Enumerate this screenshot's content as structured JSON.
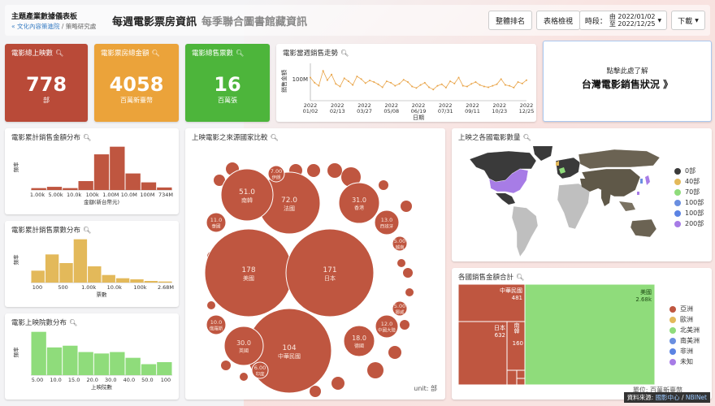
{
  "header": {
    "title": "主題產業數據儀表板",
    "crumb_link": "« 文化內容策進院",
    "crumb_sep": " / ",
    "crumb_current": "策略研究處",
    "main_title": "每週電影票房資訊",
    "sub_title": "每季聯合圖書館藏資訊",
    "btn_rank": "整體排名",
    "btn_table": "表格檢視",
    "period_label": "時段：",
    "period_from": "由 2022/01/02",
    "period_to": "至 2022/12/25",
    "btn_download": "下載"
  },
  "kpis": [
    {
      "title": "電影總上映數",
      "value": "778",
      "unit": "部",
      "color": "#b94a38"
    },
    {
      "title": "電影票房總金額",
      "value": "4058",
      "unit": "百萬新臺幣",
      "color": "#eba33a"
    },
    {
      "title": "電影總售票數",
      "value": "16",
      "unit": "百萬張",
      "color": "#4db53b"
    }
  ],
  "promo": {
    "small": "點擊此處了解",
    "big": "台灣電影銷售狀況 》"
  },
  "weekly_trend": {
    "title": "電影當週銷售走勢",
    "ylabel": "銷售金額",
    "ytick": "100M",
    "xticks": [
      "2022\n01/02",
      "2022\n02/13",
      "2022\n03/27",
      "2022\n05/08",
      "2022\n06/19",
      "2022\n07/31",
      "2022\n09/11",
      "2022\n10/23",
      "2022\n12/25"
    ],
    "xlabel": "日期",
    "color": "#e9a54a",
    "values": [
      62,
      48,
      40,
      80,
      55,
      70,
      45,
      38,
      60,
      52,
      42,
      65,
      58,
      47,
      54,
      50,
      44,
      36,
      52,
      48,
      40,
      45,
      56,
      50,
      38,
      34,
      42,
      48,
      36,
      30,
      40,
      44,
      35,
      52,
      46,
      62,
      40,
      38,
      45,
      50,
      42,
      38,
      36,
      40,
      44,
      58,
      42,
      40,
      35,
      50,
      46,
      55
    ]
  },
  "hist_amount": {
    "title": "電影累計銷售金額分布",
    "ylabel": "頻率",
    "xlabel": "金額(新台幣元)",
    "xticks": [
      "1.00k",
      "5.00k",
      "10.0k",
      "100k",
      "1.00M",
      "10.0M",
      "100M",
      "734M"
    ],
    "color": "#bf5640",
    "values": [
      3,
      5,
      3,
      14,
      56,
      68,
      26,
      12,
      4
    ]
  },
  "hist_tickets": {
    "title": "電影累計銷售票數分布",
    "ylabel": "頻率",
    "xlabel": "票數",
    "xticks": [
      "100",
      "500",
      "1.00k",
      "10.0k",
      "100k",
      "2.68M"
    ],
    "color": "#e3b95a",
    "values": [
      22,
      52,
      36,
      80,
      30,
      14,
      8,
      6,
      3,
      2
    ]
  },
  "hist_theaters": {
    "title": "電影上映院數分布",
    "ylabel": "頻率",
    "xlabel": "上映院數",
    "xticks": [
      "5.00",
      "10.0",
      "15.0",
      "20.0",
      "30.0",
      "40.0",
      "50.0",
      "100"
    ],
    "color": "#8fdc7b",
    "values": [
      150,
      96,
      102,
      80,
      75,
      80,
      60,
      38,
      45
    ]
  },
  "bubbles": {
    "title": "上映電影之來源國家比較",
    "unit": "unit: 部",
    "color": "#bf5640",
    "items": [
      {
        "value": "178",
        "label": "美國"
      },
      {
        "value": "171",
        "label": "日本"
      },
      {
        "value": "104",
        "label": "中華民國"
      },
      {
        "value": "72.0",
        "label": "法國"
      },
      {
        "value": "51.0",
        "label": "南韓"
      },
      {
        "value": "31.0",
        "label": "香港"
      },
      {
        "value": "30.0",
        "label": "英國"
      },
      {
        "value": "18.0",
        "label": "德國"
      },
      {
        "value": "13.0",
        "label": "西班牙"
      },
      {
        "value": "12.0",
        "label": "中國大陸"
      },
      {
        "value": "11.0",
        "label": "泰國"
      },
      {
        "value": "10.0",
        "label": "俄羅斯"
      },
      {
        "value": "7.00",
        "label": "伊朗"
      },
      {
        "value": "6.00",
        "label": "印度"
      },
      {
        "value": "5.00",
        "label": "越南"
      },
      {
        "value": "5.00",
        "label": "挪威"
      }
    ]
  },
  "world_map": {
    "title": "上映之各國電影數量",
    "legend": [
      {
        "label": "0部",
        "color": "#3a3a3a"
      },
      {
        "label": "40部",
        "color": "#e3b95a"
      },
      {
        "label": "70部",
        "color": "#8fdc7b"
      },
      {
        "label": "100部",
        "color": "#6a8fe0"
      },
      {
        "label": "100部",
        "color": "#5b83e3"
      },
      {
        "label": "200部",
        "color": "#a77ce6"
      }
    ]
  },
  "treemap": {
    "title": "各國銷售金額合計",
    "unit": "單位: 百萬新臺幣",
    "blocks": [
      {
        "name": "中華民國",
        "value": "481",
        "color": "#bf5640"
      },
      {
        "name": "日本",
        "value": "632",
        "color": "#bf5640"
      },
      {
        "name": "南韓",
        "value": "160",
        "color": "#bf5640"
      },
      {
        "name": "美國",
        "value": "2.68k",
        "color": "#8fdc7b"
      }
    ],
    "legend": [
      {
        "label": "亞洲",
        "color": "#bf5640"
      },
      {
        "label": "歐洲",
        "color": "#e3b95a"
      },
      {
        "label": "北美洲",
        "color": "#8fdc7b"
      },
      {
        "label": "南美洲",
        "color": "#6a8fe0"
      },
      {
        "label": "非洲",
        "color": "#5b83e3"
      },
      {
        "label": "未知",
        "color": "#a77ce6"
      }
    ]
  },
  "footer": {
    "prefix": "資料來源: ",
    "link1": "國影中心",
    "sep": " / ",
    "link2": "NBINet"
  }
}
